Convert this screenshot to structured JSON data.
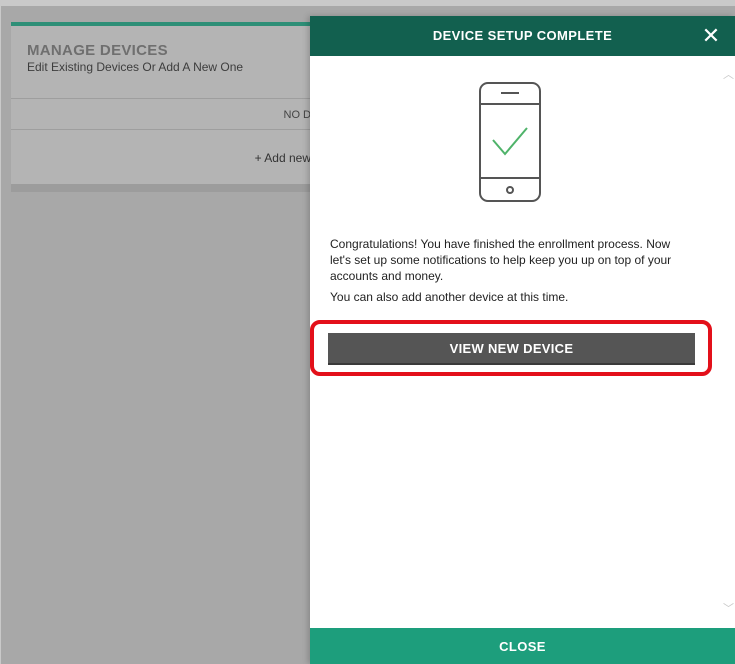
{
  "background": {
    "title": "MANAGE DEVICES",
    "subtitle": "Edit Existing Devices Or Add A New One",
    "row_text": "NO D",
    "add_text": "+ Add new"
  },
  "modal": {
    "title": "DEVICE SETUP COMPLETE",
    "close_icon": "✕",
    "paragraph1": "Congratulations! You have finished the enrollment process. Now let's set up some notifications to help keep you up on top of your accounts and money.",
    "paragraph2": "You can also add another device at this time.",
    "primary_button": "VIEW NEW DEVICE",
    "footer_button": "CLOSE"
  },
  "icons": {
    "phone": "phone-check-icon",
    "close": "close-icon",
    "scroll_up": "chevron-up-icon",
    "scroll_down": "chevron-down-icon"
  },
  "colors": {
    "header": "#12604f",
    "footer": "#1d9e7c",
    "button": "#555555",
    "highlight": "#e3101a",
    "check": "#4fb36a"
  }
}
